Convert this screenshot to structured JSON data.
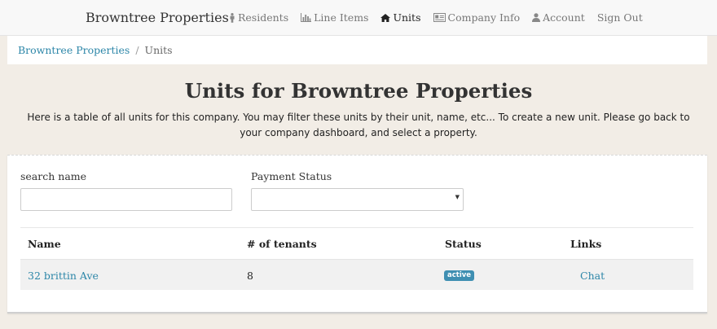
{
  "navbar": {
    "brand": "Browntree Properties",
    "items": [
      {
        "label": "Residents",
        "icon": "male-icon",
        "active": false
      },
      {
        "label": "Line Items",
        "icon": "bar-chart-icon",
        "active": false
      },
      {
        "label": "Units",
        "icon": "home-icon",
        "active": true
      },
      {
        "label": "Company Info",
        "icon": "id-card-icon",
        "active": false
      },
      {
        "label": "Account",
        "icon": "user-icon",
        "active": false
      },
      {
        "label": "Sign Out",
        "icon": "",
        "active": false
      }
    ]
  },
  "breadcrumb": {
    "home": "Browntree Properties",
    "separator": "/",
    "current": "Units"
  },
  "page": {
    "title": "Units for Browntree Properties",
    "description": "Here is a table of all units for this company. You may filter these units by their unit, name, etc... To create a new unit. Please go back to your company dashboard, and select a property."
  },
  "filters": {
    "search_label": "search name",
    "search_value": "",
    "payment_label": "Payment Status",
    "payment_value": ""
  },
  "table": {
    "headers": [
      "Name",
      "# of tenants",
      "Status",
      "Links"
    ],
    "rows": [
      {
        "name": "32 brittin Ave",
        "tenants": "8",
        "status": "active",
        "link": "Chat"
      }
    ]
  },
  "colors": {
    "background": "#f2ede6",
    "link": "#2c86a8",
    "badge": "#3f8fb2",
    "row_highlight": "#f1f1f1"
  }
}
